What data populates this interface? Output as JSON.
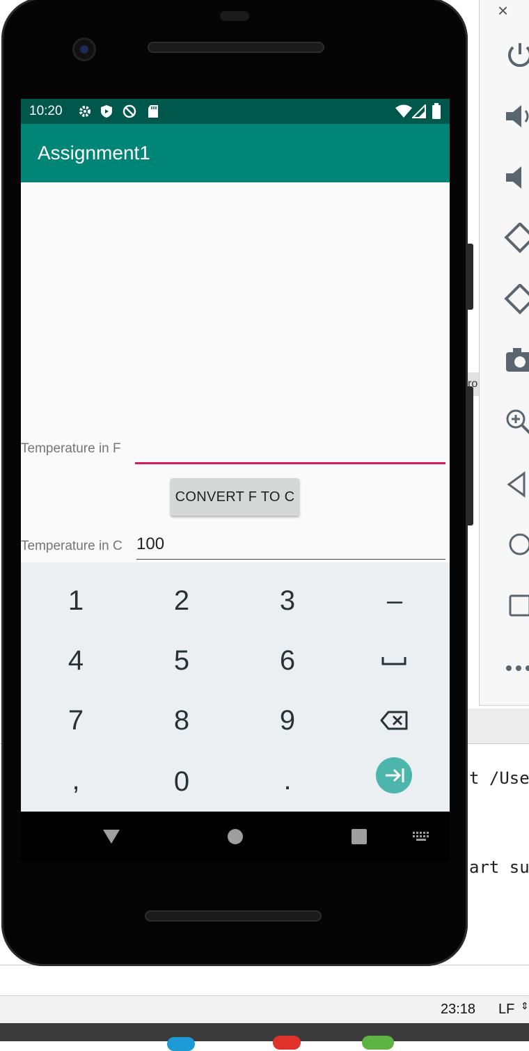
{
  "ide": {
    "console_line1": "t /User",
    "console_line2": "art suc",
    "side_tab_fragment": "ro",
    "status_time": "23:18",
    "status_encoding": "LF"
  },
  "emulator_toolbar": {
    "close_label": "×",
    "items": [
      "power-icon",
      "volume-up-icon",
      "volume-down-icon",
      "rotate-left-icon",
      "rotate-right-icon",
      "camera-icon",
      "zoom-icon",
      "back-icon",
      "home-icon",
      "overview-icon",
      "more-icon"
    ]
  },
  "phone": {
    "status_bar": {
      "time": "10:20"
    },
    "app_title": "Assignment1",
    "form": {
      "fahrenheit_label": "Temperature in F",
      "fahrenheit_value": "",
      "convert_button": "CONVERT F TO C",
      "celsius_label": "Temperature in C",
      "celsius_value": "100"
    },
    "keyboard": {
      "rows": [
        [
          "1",
          "2",
          "3",
          "–"
        ],
        [
          "4",
          "5",
          "6",
          "space"
        ],
        [
          "7",
          "8",
          "9",
          "backspace"
        ],
        [
          ",",
          "0",
          ".",
          "next"
        ]
      ]
    }
  },
  "colors": {
    "primary": "#008577",
    "primary_dark": "#00574b",
    "accent": "#d81b60",
    "keyboard_accent": "#4db6ac"
  }
}
